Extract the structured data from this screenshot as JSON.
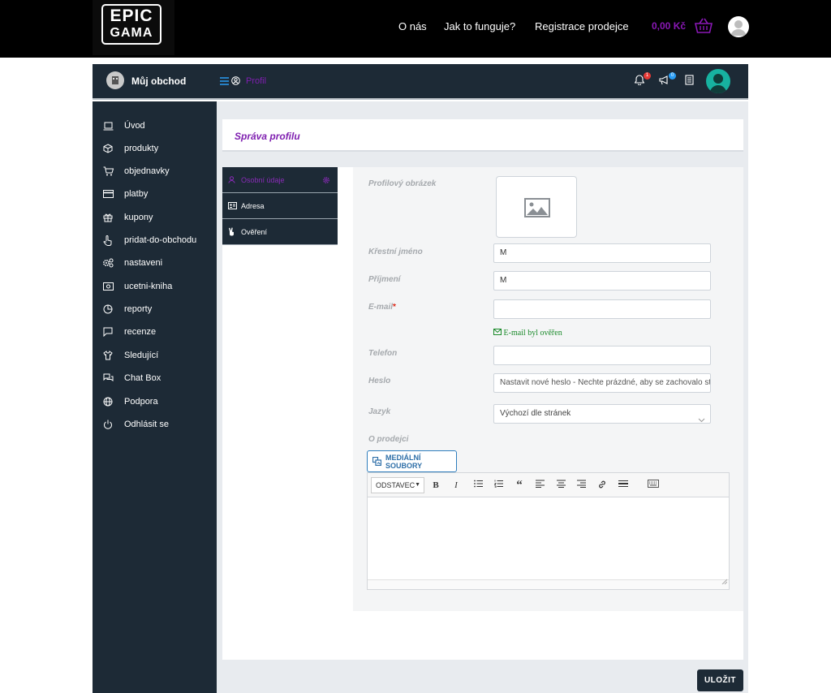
{
  "topbar": {
    "logo_line1": "EPIC",
    "logo_line2": "GAMA",
    "nav": [
      "O nás",
      "Jak to funguje?",
      "Registrace prodejce"
    ],
    "cart_price": "0,00 Kč"
  },
  "header": {
    "shop_name": "Můj obchod",
    "breadcrumb": "Profil",
    "notifications_count": "1",
    "announcements_count": "0"
  },
  "sidebar": {
    "items": [
      {
        "label": "Úvod",
        "icon": "laptop-icon"
      },
      {
        "label": "produkty",
        "icon": "box-icon"
      },
      {
        "label": "objednavky",
        "icon": "cart-icon"
      },
      {
        "label": "platby",
        "icon": "credit-card-icon"
      },
      {
        "label": "kupony",
        "icon": "gift-icon"
      },
      {
        "label": "pridat-do-obchodu",
        "icon": "hand-pointer-icon"
      },
      {
        "label": "nastaveni",
        "icon": "gears-icon"
      },
      {
        "label": "ucetni-kniha",
        "icon": "money-icon"
      },
      {
        "label": "reporty",
        "icon": "pie-chart-icon"
      },
      {
        "label": "recenze",
        "icon": "comment-icon"
      },
      {
        "label": "Sledující",
        "icon": "shirt-icon"
      },
      {
        "label": "Chat Box",
        "icon": "chat-icon"
      },
      {
        "label": "Podpora",
        "icon": "globe-icon"
      },
      {
        "label": "Odhlásit se",
        "icon": "power-icon"
      }
    ]
  },
  "page": {
    "title": "Správa profilu"
  },
  "tabs": [
    {
      "label": "Osobní údaje",
      "active": true
    },
    {
      "label": "Adresa",
      "active": false
    },
    {
      "label": "Ověření",
      "active": false
    }
  ],
  "form": {
    "profile_image_label": "Profilový obrázek",
    "first_name_label": "Křestní jméno",
    "first_name_value": "M",
    "last_name_label": "Příjmení",
    "last_name_value": "M",
    "email_label": "E-mail",
    "email_required": "*",
    "email_value": "",
    "email_verified": "E-mail byl ověřen",
    "phone_label": "Telefon",
    "phone_value": "",
    "password_label": "Heslo",
    "password_placeholder": "Nastavit nové heslo - Nechte prázdné, aby se zachovalo stávající heslo",
    "language_label": "Jazyk",
    "language_value": "Výchozí dle stránek",
    "about_label": "O prodejci",
    "media_button": "MEDIÁLNÍ SOUBORY",
    "editor_format": "ODSTAVEC"
  },
  "actions": {
    "save": "ULOŽIT"
  },
  "colors": {
    "accent": "#7f1fb0",
    "dark_panel": "#1d2a36",
    "verified": "#1a8a2a"
  }
}
